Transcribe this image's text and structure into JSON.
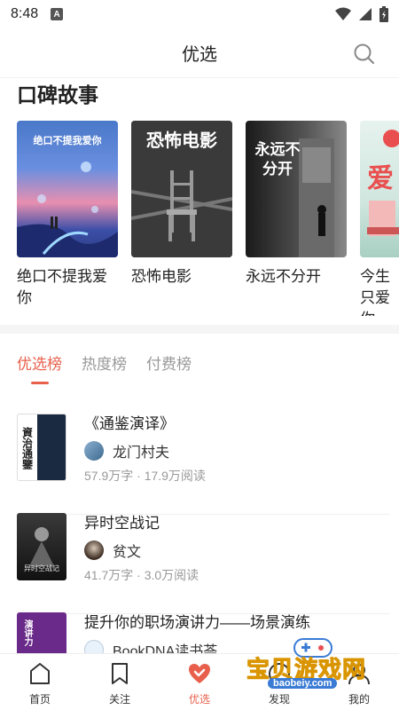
{
  "status_bar": {
    "time": "8:48",
    "notif_letter": "A"
  },
  "header": {
    "title": "优选"
  },
  "section": {
    "title": "口碑故事"
  },
  "books": [
    {
      "title": "绝口不提我爱你",
      "cover_text": "绝口不提我爱你"
    },
    {
      "title": "恐怖电影",
      "cover_text": "恐怖电影"
    },
    {
      "title": "永远不分开",
      "cover_text": "永远不分开"
    },
    {
      "title": "今生只爱你",
      "cover_text": "爱"
    }
  ],
  "tabs": [
    {
      "label": "优选榜",
      "active": true
    },
    {
      "label": "热度榜",
      "active": false
    },
    {
      "label": "付费榜",
      "active": false
    }
  ],
  "ranking": [
    {
      "title": "《通鉴演译》",
      "author": "龙门村夫",
      "meta": "57.9万字 · 17.9万阅读",
      "cover_text": "資治通鑒"
    },
    {
      "title": "异时空战记",
      "author": "贫文",
      "meta": "41.7万字 · 3.0万阅读",
      "cover_text": "异时空战记"
    },
    {
      "title": "提升你的职场演讲力——场景演练",
      "author": "BookDNA读书荟",
      "meta": "",
      "cover_text": "演讲力"
    }
  ],
  "nav": [
    {
      "label": "首页",
      "icon": "home-icon"
    },
    {
      "label": "关注",
      "icon": "bookmark-icon"
    },
    {
      "label": "优选",
      "icon": "heart-check-icon",
      "active": true
    },
    {
      "label": "发现",
      "icon": "discover-icon"
    },
    {
      "label": "我的",
      "icon": "profile-icon"
    }
  ],
  "watermark": {
    "text": "宝贝游戏网",
    "url": "baobeiy.com"
  },
  "colors": {
    "accent": "#e8604c"
  }
}
